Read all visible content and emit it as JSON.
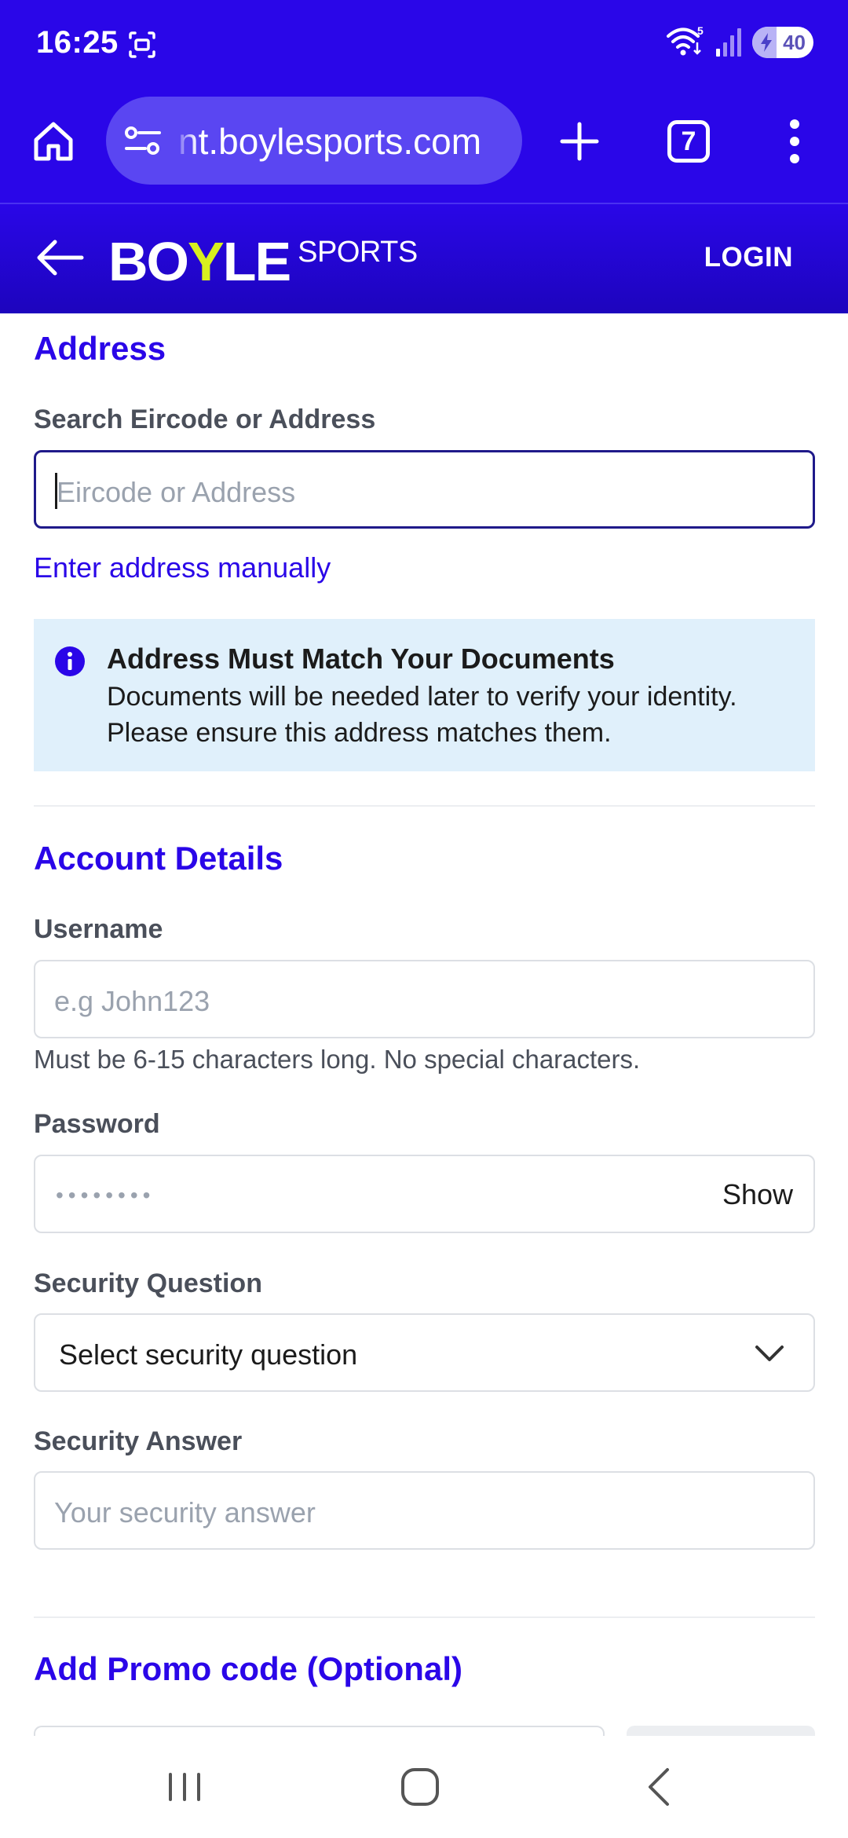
{
  "status_bar": {
    "time": "16:25",
    "battery": "40",
    "battery_level": 0.4
  },
  "browser": {
    "url": "nt.boylesports.com",
    "tabs_count": "7"
  },
  "site_header": {
    "logo_main_a": "BO",
    "logo_main_y": "Y",
    "logo_main_b": "LE",
    "logo_sub": "SPORTS",
    "login_label": "LOGIN"
  },
  "address": {
    "section_title": "Address",
    "search_label": "Search Eircode or Address",
    "search_placeholder": "Eircode or Address",
    "manual_link": "Enter address manually",
    "info_title": "Address Must Match Your Documents",
    "info_body": "Documents will be needed later to verify your identity. Please ensure this address matches them."
  },
  "account": {
    "section_title": "Account Details",
    "username_label": "Username",
    "username_placeholder": "e.g John123",
    "username_help": "Must be 6-15 characters long. No special characters.",
    "password_label": "Password",
    "password_mask": "••••••••",
    "show_label": "Show",
    "security_question_label": "Security Question",
    "security_question_value": "Select security question",
    "security_answer_label": "Security Answer",
    "security_answer_placeholder": "Your security answer"
  },
  "promo": {
    "section_title": "Add Promo code (Optional)"
  },
  "colors": {
    "brand_blue": "#2a06e8",
    "brand_lime": "#d8f01e",
    "info_bg": "#e0f0fb"
  },
  "icons": {
    "status": [
      "screenshot-icon",
      "wifi-icon",
      "signal-icon",
      "battery-charging-icon"
    ],
    "browser": [
      "home-icon",
      "tune-icon",
      "plus-icon",
      "tabs-icon",
      "more-vert-icon"
    ],
    "nav": [
      "recents-icon",
      "home-circle-icon",
      "back-chevron-icon"
    ]
  }
}
